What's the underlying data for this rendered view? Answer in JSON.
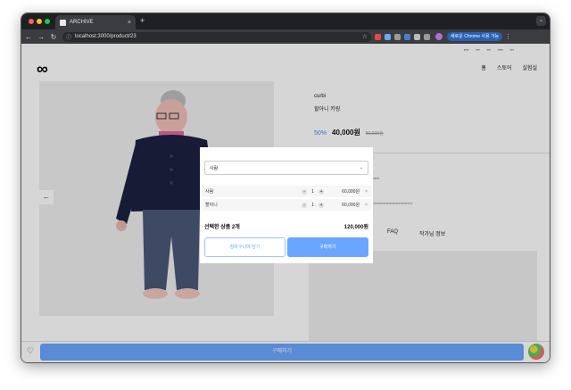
{
  "browser": {
    "tab_title": "ARCHIVE",
    "tab_close": "×",
    "new_tab": "+",
    "tab_menu": "⌄",
    "url": "localhost:3000/product/23",
    "nav_back": "←",
    "nav_forward": "→",
    "nav_reload": "↻",
    "bookmark_star": "☆",
    "update_label": "새로운 Chrome 사용 가능",
    "menu_dots": "⋮"
  },
  "site": {
    "logo": "∞",
    "main_nav": [
      "홈",
      "스토어",
      "실험실"
    ]
  },
  "product": {
    "brand": "curbi",
    "name": "할아니 키링",
    "discount": "50%",
    "price": "40,000원",
    "original_price": "80,000원"
  },
  "detail_tabs": [
    "FAQ",
    "작가님 정보"
  ],
  "buybar": {
    "heart": "♡",
    "buy_label": "구매하기"
  },
  "gallery": {
    "prev": "←"
  },
  "modal": {
    "select_value": "사람",
    "chevron": "⌄",
    "options": [
      {
        "name": "사람",
        "minus": "-",
        "qty": "1",
        "plus": "+",
        "price": "60,000원",
        "remove": "×"
      },
      {
        "name": "할아니",
        "minus": "-",
        "qty": "1",
        "plus": "+",
        "price": "60,000원",
        "remove": "×"
      }
    ],
    "summary_label": "선택한 상품 2개",
    "summary_total": "120,000원",
    "cart_button": "장바구니에 담기",
    "buy_button": "구매하기"
  }
}
